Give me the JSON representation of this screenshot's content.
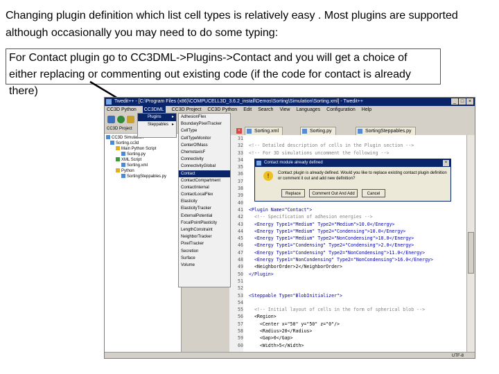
{
  "intro_text": "Changing plugin definition which list cell types is relatively easy . Most plugins are supported although occasionally you may need to do some typing:",
  "box_text": "For Contact plugin go to CC3DML->Plugins->Contact and you will get a choice of either replacing or commenting out existing code (if the code for contact is already there)",
  "colors": {
    "arrow": "#000000",
    "titlebar": "#0a246a",
    "selection": "#0a246a",
    "dialog_bg": "#ece9d8"
  },
  "screenshot": {
    "window_title": "Twedit++ - [C:\\Program Files (x86)\\COMPUCELL3D_3.6.2_install\\Demos\\Sorting\\Simulation\\Sorting.xml] - Twedit++",
    "menubar": [
      "CC3D Python",
      "CC3DML",
      "CC3D Project",
      "CC3D Python",
      "Edit",
      "Search",
      "View",
      "Languages",
      "Configuration",
      "Help"
    ],
    "left_tab": "CC3D Project",
    "tree": [
      {
        "label": "CC3D Simulation",
        "icon": "simulation-icon"
      },
      {
        "label": "Sorting.cc3d",
        "icon": "project-icon"
      },
      {
        "label": "Main Python Script",
        "icon": "python-icon"
      },
      {
        "label": "Sorting.py",
        "icon": "file-icon"
      },
      {
        "label": "XML Script",
        "icon": "xml-icon"
      },
      {
        "label": "Sorting.xml",
        "icon": "file-icon"
      },
      {
        "label": "Python",
        "icon": "python-icon"
      },
      {
        "label": "SortingSteppables.py",
        "icon": "file-icon"
      }
    ],
    "cc3dml_menu": {
      "items": [
        {
          "label": "Plugins",
          "selected": true
        },
        {
          "label": "Steppables",
          "selected": false
        }
      ]
    },
    "plugins_menu": {
      "items": [
        "AdhesionFlex",
        "BoundaryPixelTracker",
        "CellType",
        "CellTypeMonitor",
        "CenterOfMass",
        "ChemotaxisF",
        "Connectivity",
        "ConnectivityGlobal",
        "Contact",
        "ContactCompartment",
        "ContactInternal",
        "ContactLocalFlex",
        "Elasticity",
        "ElasticityTracker",
        "ExternalPotential",
        "FocalPointPlasticity",
        "LengthConstraint",
        "NeighborTracker",
        "PixelTracker",
        "Secretion",
        "Surface",
        "Volume"
      ],
      "selected": "Contact"
    },
    "tabs": [
      {
        "label": "Sorting.xml"
      },
      {
        "label": "Sorting.py"
      },
      {
        "label": "SortingSteppables.py"
      }
    ],
    "line_numbers": [
      "31",
      "32",
      "33",
      "34",
      "35",
      "36",
      "37",
      "38",
      "39",
      "40",
      "41",
      "42",
      "43",
      "44",
      "45",
      "46",
      "47",
      "48",
      "49",
      "50",
      "51",
      "52",
      "53",
      "54",
      "55",
      "56",
      "57",
      "58",
      "59",
      "60"
    ],
    "code_lines": [
      "",
      "<!-- Detailed description of cells in the Plugin section -->",
      "<!-- For 3D simulations uncomment the following -->",
      "",
      "",
      "",
      "",
      "",
      "",
      "",
      "<Plugin Name=\"Contact\">",
      "  <!-- Specification of adhesion energies -->",
      "  <Energy Type1=\"Medium\" Type2=\"Medium\">10.0</Energy>",
      "  <Energy Type1=\"Medium\" Type2=\"Condensing\">10.0</Energy>",
      "  <Energy Type1=\"Medium\" Type2=\"NonCondensing\">10.0</Energy>",
      "  <Energy Type1=\"Condensing\" Type2=\"Condensing\">2.0</Energy>",
      "  <Energy Type1=\"Condensing\" Type2=\"NonCondensing\">11.0</Energy>",
      "  <Energy Type1=\"NonCondensing\" Type2=\"NonCondensing\">16.0</Energy>",
      "  <NeighborOrder>2</NeighborOrder>",
      "</Plugin>",
      "",
      "",
      "<Steppable Type=\"BlobInitializer\">",
      "",
      "  <!-- Initial layout of cells in the form of spherical blob -->",
      "  <Region>",
      "    <Center x=\"50\" y=\"50\" z=\"0\"/>",
      "    <Radius>20</Radius>",
      "    <Gap>0</Gap>",
      "    <Width>5</Width>"
    ],
    "dialog": {
      "title": "Contact module already defined",
      "message": "Contact plugin is already defined. Would you like to replace existing contact plugin definition or comment it out and add new definition?",
      "buttons": [
        "Replace",
        "Comment Out And Add",
        "Cancel"
      ]
    },
    "status_text": "UTF-8"
  }
}
